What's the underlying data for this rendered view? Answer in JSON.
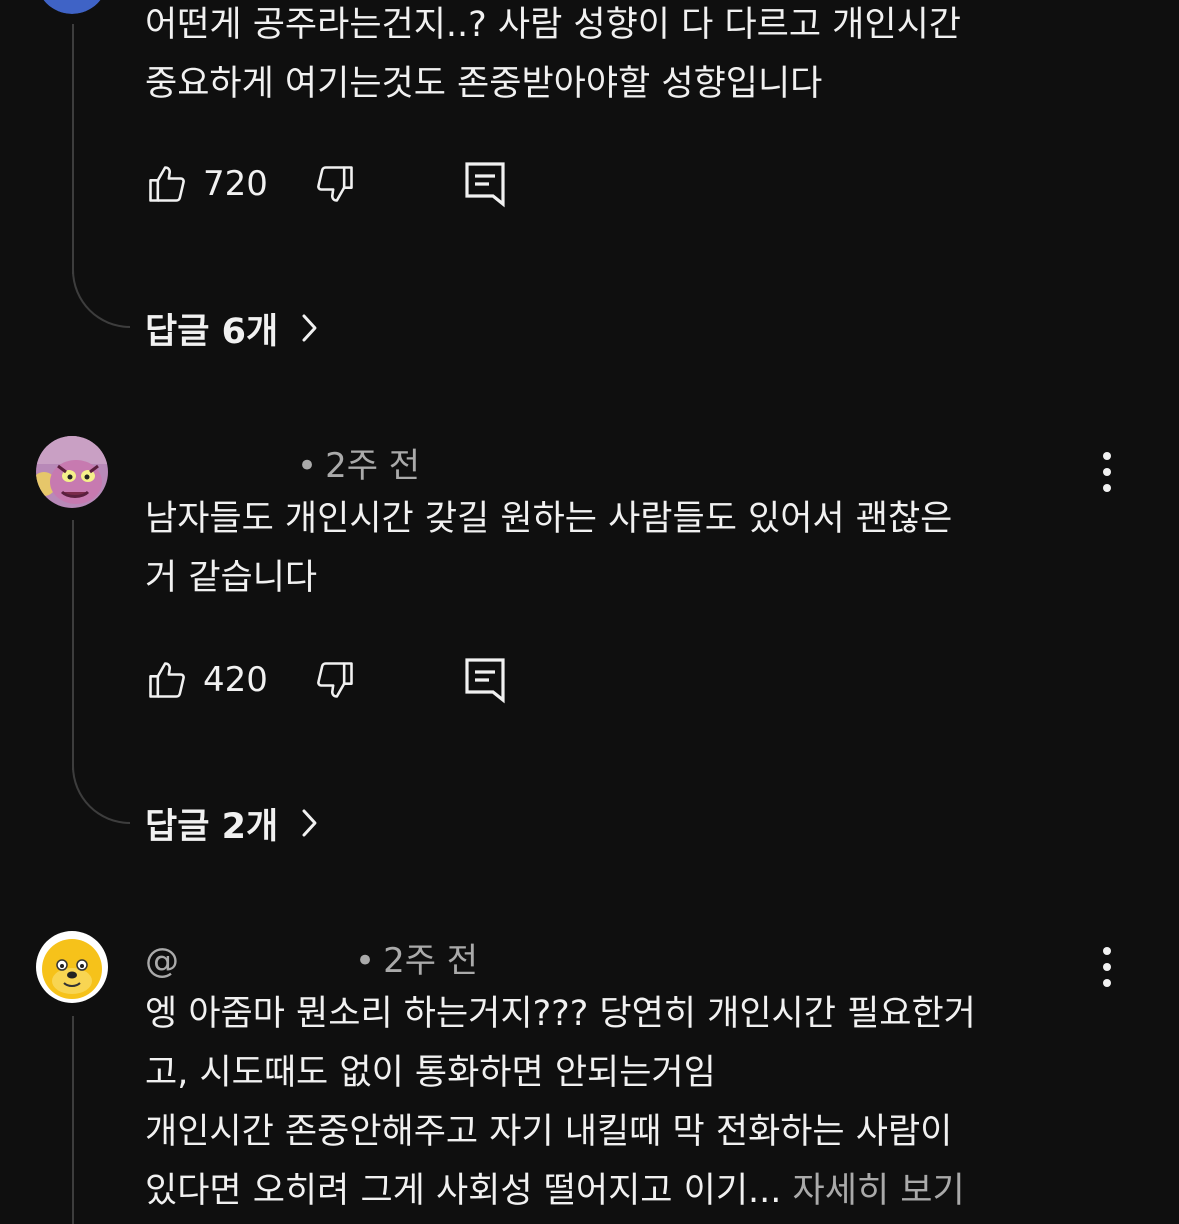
{
  "comments": [
    {
      "text_lines": [
        "어떤게 공주라는건지..? 사람 성향이 다 다르고 개인시간",
        "중요하게 여기는것도 존중받아야할 성향입니다"
      ],
      "likes": "720",
      "replies_label": "답글 6개"
    },
    {
      "handle": "",
      "time": "2주 전",
      "text_lines": [
        "남자들도 개인시간 갖길 원하는 사람들도 있어서  괜찮은",
        "거 같습니다"
      ],
      "likes": "420",
      "replies_label": "답글 2개"
    },
    {
      "handle": "@",
      "time": "2주 전",
      "text_lines": [
        "엥 아줌마 뭔소리 하는거지??? 당연히 개인시간 필요한거",
        "고, 시도때도 없이 통화하면 안되는거임",
        "개인시간 존중안해주고 자기 내킬때 막 전화하는 사람이",
        "있다면 오히려 그게 사회성 떨어지고 이기..."
      ],
      "more_label": "자세히 보기"
    }
  ],
  "icons": {
    "like": "thumbs-up-icon",
    "dislike": "thumbs-down-icon",
    "reply": "reply-comment-icon",
    "more": "chevron-right-icon",
    "menu": "more-vert-icon"
  },
  "colors": {
    "background": "#0f0f0f",
    "text": "#f1f1f1",
    "secondary": "#aaaaaa",
    "thread": "#3d3d3d"
  }
}
